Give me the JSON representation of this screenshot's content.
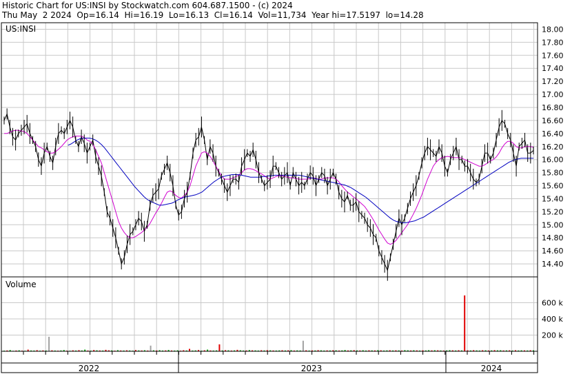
{
  "header": {
    "line1": "Historic Chart for US:INSI by Stockwatch.com 604.687.1500 - (c) 2024",
    "line2": "Thu May  2 2024  Op=16.14  Hi=16.19  Lo=16.13  Cl=16.14  Vol=11,734  Year hi=17.5197  lo=14.28"
  },
  "chart_data": [
    {
      "type": "line",
      "panel": "price",
      "label": "US:INSI",
      "ylim": [
        14.2,
        18.1
      ],
      "yticks": [
        14.4,
        14.6,
        14.8,
        15.0,
        15.2,
        15.4,
        15.6,
        15.8,
        16.0,
        16.2,
        16.4,
        16.6,
        16.8,
        17.0,
        17.2,
        17.4,
        17.6,
        17.8,
        18.0
      ],
      "ytick_labels": [
        "14.40",
        "14.60",
        "14.80",
        "15.00",
        "15.20",
        "15.40",
        "15.60",
        "15.80",
        "16.00",
        "16.20",
        "16.40",
        "16.60",
        "16.80",
        "17.00",
        "17.20",
        "17.40",
        "17.60",
        "17.80",
        "18.00"
      ],
      "x_labels": [
        "2022",
        "2023",
        "2024"
      ],
      "grid": true,
      "series": [
        {
          "key": "price",
          "color": "#000000",
          "values": [
            16.6,
            16.7,
            16.5,
            16.35,
            16.3,
            16.4,
            16.45,
            16.5,
            16.55,
            16.4,
            16.3,
            16.2,
            16.0,
            15.9,
            16.1,
            16.2,
            16.05,
            15.95,
            16.2,
            16.4,
            16.45,
            16.4,
            16.5,
            16.6,
            16.5,
            16.3,
            16.2,
            16.35,
            16.25,
            16.1,
            16.2,
            16.3,
            16.05,
            15.9,
            15.75,
            15.5,
            15.2,
            15.1,
            14.95,
            14.8,
            14.6,
            14.4,
            14.5,
            14.7,
            14.85,
            14.9,
            15.0,
            15.1,
            15.05,
            14.9,
            15.0,
            15.3,
            15.45,
            15.5,
            15.55,
            15.75,
            15.85,
            15.95,
            15.8,
            15.6,
            15.3,
            15.15,
            15.2,
            15.4,
            15.5,
            15.75,
            16.1,
            16.3,
            16.35,
            16.5,
            16.3,
            16.0,
            16.2,
            16.1,
            15.9,
            15.8,
            15.7,
            15.6,
            15.5,
            15.6,
            15.7,
            15.7,
            15.65,
            15.9,
            16.0,
            16.1,
            16.05,
            16.15,
            16.0,
            15.8,
            15.7,
            15.6,
            15.65,
            15.7,
            15.9,
            15.9,
            15.8,
            15.7,
            15.75,
            15.8,
            15.6,
            15.8,
            15.7,
            15.6,
            15.65,
            15.6,
            15.7,
            15.8,
            15.75,
            15.6,
            15.7,
            15.8,
            15.75,
            15.6,
            15.7,
            15.8,
            15.7,
            15.5,
            15.4,
            15.35,
            15.45,
            15.3,
            15.3,
            15.35,
            15.2,
            15.15,
            15.1,
            15.0,
            14.95,
            14.85,
            14.8,
            14.6,
            14.5,
            14.4,
            14.3,
            14.5,
            14.7,
            14.9,
            15.1,
            15.0,
            15.1,
            15.25,
            15.4,
            15.5,
            15.6,
            15.75,
            15.95,
            16.1,
            16.2,
            16.15,
            16.1,
            16.05,
            16.2,
            16.1,
            15.9,
            15.8,
            16.0,
            16.1,
            16.2,
            16.0,
            16.0,
            15.9,
            15.9,
            15.8,
            15.7,
            15.65,
            15.7,
            15.9,
            16.1,
            16.1,
            16.0,
            16.1,
            16.3,
            16.5,
            16.6,
            16.55,
            16.4,
            16.3,
            16.1,
            15.9,
            16.2,
            16.25,
            16.3,
            16.1,
            16.1,
            16.14
          ]
        },
        {
          "key": "ma-short",
          "color": "#d000d0",
          "values": [
            16.4,
            16.4,
            16.42,
            16.44,
            16.45,
            16.45,
            16.44,
            16.43,
            16.4,
            16.35,
            16.3,
            16.25,
            16.2,
            16.18,
            16.15,
            16.12,
            16.1,
            16.1,
            16.12,
            16.16,
            16.2,
            16.25,
            16.3,
            16.33,
            16.35,
            16.36,
            16.36,
            16.36,
            16.34,
            16.3,
            16.28,
            16.24,
            16.15,
            16.05,
            15.95,
            15.8,
            15.65,
            15.5,
            15.35,
            15.2,
            15.05,
            14.95,
            14.88,
            14.83,
            14.8,
            14.8,
            14.82,
            14.85,
            14.88,
            14.92,
            14.96,
            15.02,
            15.1,
            15.18,
            15.25,
            15.33,
            15.42,
            15.5,
            15.52,
            15.5,
            15.45,
            15.42,
            15.41,
            15.45,
            15.5,
            15.6,
            15.75,
            15.9,
            16.0,
            16.1,
            16.12,
            16.1,
            16.05,
            15.98,
            15.9,
            15.82,
            15.75,
            15.7,
            15.7,
            15.7,
            15.72,
            15.74,
            15.76,
            15.8,
            15.84,
            15.86,
            15.86,
            15.85,
            15.83,
            15.8,
            15.78,
            15.75,
            15.72,
            15.7,
            15.72,
            15.74,
            15.75,
            15.75,
            15.74,
            15.73,
            15.72,
            15.72,
            15.71,
            15.7,
            15.7,
            15.7,
            15.7,
            15.71,
            15.72,
            15.71,
            15.7,
            15.7,
            15.72,
            15.72,
            15.72,
            15.72,
            15.7,
            15.66,
            15.6,
            15.55,
            15.5,
            15.47,
            15.43,
            15.4,
            15.36,
            15.32,
            15.28,
            15.22,
            15.15,
            15.08,
            15.0,
            14.92,
            14.85,
            14.78,
            14.72,
            14.7,
            14.72,
            14.76,
            14.82,
            14.88,
            14.94,
            15.0,
            15.08,
            15.16,
            15.25,
            15.35,
            15.46,
            15.58,
            15.7,
            15.8,
            15.9,
            15.96,
            16.0,
            16.03,
            16.04,
            16.05,
            16.04,
            16.03,
            16.03,
            16.03,
            16.02,
            16.0,
            15.98,
            15.96,
            15.94,
            15.92,
            15.9,
            15.9,
            15.92,
            15.95,
            15.98,
            16.0,
            16.04,
            16.1,
            16.18,
            16.24,
            16.28,
            16.28,
            16.25,
            16.2,
            16.18,
            16.18,
            16.2,
            16.2,
            16.2,
            16.19
          ]
        },
        {
          "key": "ma-long",
          "color": "#0000c0",
          "values": [
            null,
            null,
            null,
            null,
            null,
            null,
            null,
            null,
            null,
            null,
            null,
            null,
            null,
            null,
            null,
            null,
            null,
            null,
            null,
            null,
            null,
            16.22,
            16.24,
            16.27,
            16.3,
            16.32,
            16.33,
            16.33,
            16.33,
            16.32,
            16.3,
            16.27,
            16.23,
            16.18,
            16.12,
            16.06,
            16.0,
            15.94,
            15.88,
            15.82,
            15.76,
            15.7,
            15.64,
            15.58,
            15.53,
            15.48,
            15.43,
            15.39,
            15.36,
            15.34,
            15.32,
            15.3,
            15.3,
            15.31,
            15.32,
            15.33,
            15.35,
            15.38,
            15.4,
            15.42,
            15.43,
            15.44,
            15.45,
            15.46,
            15.48,
            15.5,
            15.54,
            15.58,
            15.62,
            15.66,
            15.69,
            15.72,
            15.74,
            15.75,
            15.76,
            15.77,
            15.77,
            15.77,
            15.76,
            15.75,
            15.74,
            15.73,
            15.73,
            15.73,
            15.73,
            15.74,
            15.74,
            15.75,
            15.75,
            15.76,
            15.76,
            15.76,
            15.76,
            15.76,
            15.76,
            15.76,
            15.76,
            15.76,
            15.75,
            15.74,
            15.73,
            15.72,
            15.71,
            15.7,
            15.69,
            15.68,
            15.67,
            15.66,
            15.65,
            15.64,
            15.63,
            15.62,
            15.61,
            15.59,
            15.57,
            15.54,
            15.51,
            15.48,
            15.45,
            15.42,
            15.38,
            15.34,
            15.3,
            15.26,
            15.22,
            15.18,
            15.14,
            15.1,
            15.07,
            15.05,
            15.04,
            15.03,
            15.03,
            15.04,
            15.05,
            15.06,
            15.08,
            15.1,
            15.12,
            15.15,
            15.18,
            15.21,
            15.24,
            15.27,
            15.3,
            15.33,
            15.36,
            15.39,
            15.42,
            15.45,
            15.48,
            15.51,
            15.54,
            15.57,
            15.6,
            15.63,
            15.66,
            15.69,
            15.72,
            15.75,
            15.78,
            15.81,
            15.84,
            15.87,
            15.9,
            15.93,
            15.96,
            15.98,
            16.0,
            16.01,
            16.02,
            16.02,
            16.02,
            16.02,
            16.02
          ]
        }
      ]
    },
    {
      "type": "bar",
      "panel": "volume",
      "label": "Volume",
      "ylim": [
        0,
        800
      ],
      "yticks": [
        200,
        400,
        600
      ],
      "ytick_labels": [
        "200 k",
        "400 k",
        "600 k"
      ],
      "up_color": "#00a000",
      "down_color": "#e00000",
      "spike_color": "#a0a0a0",
      "values": [
        8,
        10,
        15,
        6,
        9,
        12,
        8,
        7,
        20,
        10,
        9,
        14,
        8,
        11,
        9,
        180,
        12,
        9,
        8,
        10,
        15,
        8,
        7,
        12,
        9,
        14,
        10,
        20,
        9,
        8,
        15,
        12,
        10,
        9,
        18,
        12,
        11,
        8,
        14,
        10,
        9,
        12,
        10,
        8,
        15,
        11,
        10,
        13,
        9,
        70,
        12,
        10,
        14,
        9,
        11,
        16,
        10,
        9,
        12,
        8,
        13,
        10,
        30,
        9,
        11,
        15,
        8,
        12,
        20,
        10,
        9,
        11,
        85,
        10,
        14,
        12,
        9,
        11,
        18,
        13,
        9,
        10,
        15,
        12,
        11,
        9,
        13,
        10,
        14,
        12,
        10,
        9,
        11,
        13,
        10,
        12,
        14,
        9,
        11,
        10,
        130,
        12,
        9,
        11,
        10,
        14,
        12,
        9,
        11,
        10,
        13,
        12,
        9,
        11,
        15,
        10,
        12,
        14,
        11,
        10,
        13,
        9,
        12,
        11,
        10,
        14,
        12,
        9,
        11,
        13,
        10,
        12,
        11,
        9,
        14,
        12,
        10,
        13,
        11,
        9,
        12,
        10,
        14,
        11,
        13,
        12,
        10,
        9,
        11,
        14,
        12,
        10,
        13,
        11,
        690,
        12,
        10,
        14,
        11,
        9,
        13,
        12,
        10,
        11,
        14,
        12,
        13,
        10,
        11,
        12,
        9,
        13,
        10,
        12,
        11,
        10,
        13,
        12
      ],
      "up_flags": [
        1,
        0,
        1,
        1,
        0,
        1,
        0,
        1,
        0,
        1,
        1,
        0,
        1,
        0,
        1,
        2,
        0,
        1,
        0,
        1,
        1,
        0,
        1,
        0,
        1,
        0,
        1,
        1,
        0,
        1,
        0,
        1,
        0,
        1,
        0,
        0,
        1,
        0,
        1,
        0,
        1,
        0,
        1,
        1,
        0,
        1,
        0,
        1,
        0,
        2,
        1,
        0,
        1,
        1,
        0,
        1,
        0,
        1,
        1,
        0,
        0,
        1,
        0,
        1,
        1,
        0,
        1,
        0,
        1,
        0,
        1,
        1,
        0,
        1,
        0,
        1,
        0,
        1,
        0,
        1,
        1,
        0,
        1,
        0,
        1,
        1,
        0,
        1,
        0,
        1,
        0,
        1,
        1,
        0,
        1,
        0,
        1,
        0,
        1,
        1,
        2,
        0,
        1,
        0,
        1,
        0,
        1,
        1,
        0,
        1,
        0,
        1,
        0,
        1,
        1,
        0,
        1,
        0,
        1,
        0,
        1,
        1,
        0,
        1,
        0,
        1,
        0,
        1,
        1,
        0,
        1,
        0,
        1,
        0,
        1,
        1,
        0,
        1,
        0,
        1,
        0,
        1,
        1,
        0,
        1,
        0,
        1,
        0,
        1,
        1,
        0,
        1,
        0,
        1,
        0,
        0,
        1,
        0,
        1,
        1,
        0,
        1,
        0,
        1,
        0,
        1,
        1,
        0,
        1,
        0,
        1,
        0,
        1,
        1,
        0,
        1,
        0,
        1,
        0,
        1
      ]
    }
  ]
}
